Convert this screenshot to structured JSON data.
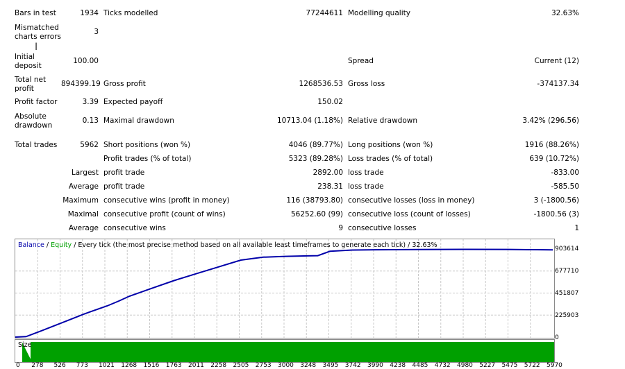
{
  "report": {
    "bars_label": "Bars in test",
    "bars_value": "1934",
    "ticks_label": "Ticks modelled",
    "ticks_value": "77244611",
    "quality_label": "Modelling quality",
    "quality_value": "32.63%",
    "mismatch_label": "Mismatched charts errors",
    "mismatch_value": "3",
    "deposit_label": "Initial deposit",
    "deposit_value": "100.00",
    "spread_label": "Spread",
    "spread_value": "Current (12)",
    "net_label": "Total net profit",
    "net_value": "894399.19",
    "gross_profit_label": "Gross profit",
    "gross_profit_value": "1268536.53",
    "gross_loss_label": "Gross loss",
    "gross_loss_value": "-374137.34",
    "pf_label": "Profit factor",
    "pf_value": "3.39",
    "ep_label": "Expected payoff",
    "ep_value": "150.02",
    "abs_dd_label": "Absolute drawdown",
    "abs_dd_value": "0.13",
    "max_dd_label": "Maximal drawdown",
    "max_dd_value": "10713.04 (1.18%)",
    "rel_dd_label": "Relative drawdown",
    "rel_dd_value": "3.42% (296.56)",
    "trades_label": "Total trades",
    "trades_value": "5962",
    "short_label": "Short positions (won %)",
    "short_value": "4046 (89.77%)",
    "long_label": "Long positions (won %)",
    "long_value": "1916 (88.26%)",
    "profit_trades_label": "Profit trades (% of total)",
    "profit_trades_value": "5323 (89.28%)",
    "loss_trades_label": "Loss trades (% of total)",
    "loss_trades_value": "639 (10.72%)",
    "largest_label": "Largest",
    "largest_profit_label": "profit trade",
    "largest_profit_value": "2892.00",
    "largest_loss_label": "loss trade",
    "largest_loss_value": "-833.00",
    "average_label": "Average",
    "average_profit_label": "profit trade",
    "average_profit_value": "238.31",
    "average_loss_label": "loss trade",
    "average_loss_value": "-585.50",
    "maximum_label": "Maximum",
    "max_cw_label": "consecutive wins (profit in money)",
    "max_cw_value": "116 (38793.80)",
    "max_cl_label": "consecutive losses (loss in money)",
    "max_cl_value": "3 (-1800.56)",
    "maximal_label": "Maximal",
    "maximal_cp_label": "consecutive profit (count of wins)",
    "maximal_cp_value": "56252.60 (99)",
    "maximal_cl_label": "consecutive loss (count of losses)",
    "maximal_cl_value": "-1800.56 (3)",
    "avg2_label": "Average",
    "avg_cw_label": "consecutive wins",
    "avg_cw_value": "9",
    "avg_cl_label": "consecutive losses",
    "avg_cl_value": "1"
  },
  "chart": {
    "title_balance": "Balance",
    "title_sep1": " / ",
    "title_equity": "Equity",
    "title_rest": " / Every tick (the most precise method based on all available least timeframes to generate each tick) / 32.63%",
    "size_label": "Size",
    "colors": {
      "balance": "#0000aa",
      "equity": "#00a000",
      "size": "#00a000",
      "grid": "#c8c8c8"
    }
  },
  "chart_data": {
    "type": "line",
    "title": "Balance / Equity / Every tick (the most precise method based on all available least timeframes to generate each tick) / 32.63%",
    "xlabel": "",
    "ylabel": "",
    "yticks": [
      "903614",
      "677710",
      "451807",
      "225903",
      "0"
    ],
    "xticks": [
      "0",
      "278",
      "526",
      "773",
      "1021",
      "1268",
      "1516",
      "1763",
      "2011",
      "2258",
      "2505",
      "2753",
      "3000",
      "3248",
      "3495",
      "3742",
      "3990",
      "4238",
      "4485",
      "4732",
      "4980",
      "5227",
      "5475",
      "5722",
      "5970"
    ],
    "xlim": [
      0,
      5970
    ],
    "ylim": [
      0,
      903614
    ],
    "grid": true,
    "series": [
      {
        "name": "Balance",
        "x": [
          0,
          120,
          278,
          526,
          773,
          1021,
          1150,
          1268,
          1516,
          1763,
          2011,
          2258,
          2505,
          2753,
          3000,
          3248,
          3360,
          3495,
          3742,
          3990,
          4485,
          4980,
          5475,
          5970
        ],
        "y": [
          0,
          5000,
          60000,
          150000,
          240000,
          320000,
          370000,
          420000,
          500000,
          580000,
          650000,
          720000,
          790000,
          820000,
          828000,
          833000,
          835000,
          880000,
          893000,
          896000,
          898000,
          900000,
          899000,
          894399
        ]
      }
    ]
  }
}
